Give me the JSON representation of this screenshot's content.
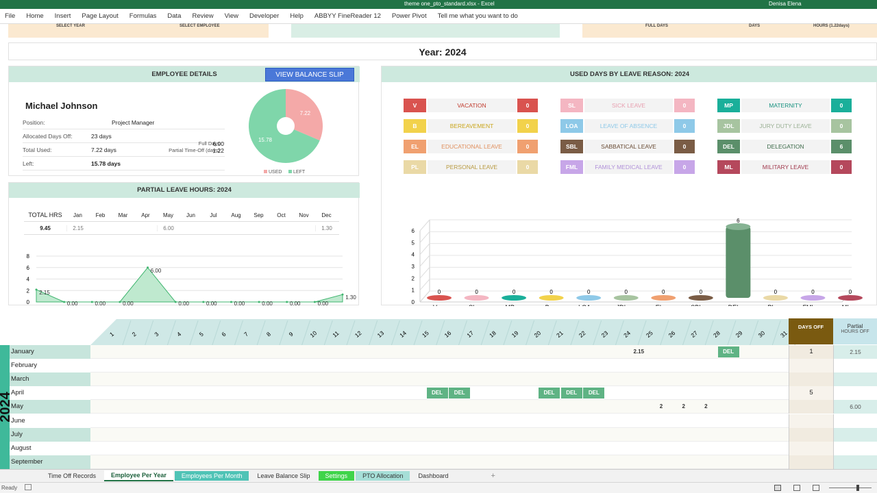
{
  "window": {
    "title": "theme one_pto_standard.xlsx - Excel",
    "user": "Denisa Elena"
  },
  "ribbon": [
    "File",
    "Home",
    "Insert",
    "Page Layout",
    "Formulas",
    "Data",
    "Review",
    "View",
    "Developer",
    "Help",
    "ABBYY FineReader 12",
    "Power Pivot",
    "Tell me what you want to do"
  ],
  "top_headers": {
    "select_year": "SELECT YEAR",
    "select_employee": "SELECT EMPLOYEE",
    "full_days": "FULL DAYS",
    "days": "DAYS",
    "hours": "HOURS (1.22days)"
  },
  "year_title": "Year: 2024",
  "employee": {
    "header": "EMPLOYEE DETAILS",
    "button": "VIEW BALANCE SLIP",
    "name": "Michael Johnson",
    "position_label": "Position:",
    "position": "Project Manager",
    "allocated_label": "Allocated Days Off:",
    "allocated": "23 days",
    "used_label": "Total Used:",
    "used": "7.22 days",
    "left_label": "Left:",
    "left": "15.78 days",
    "full_days_label": "Full Days",
    "full_days": "6.00",
    "partial_label": "Partial Time-Off (days)",
    "partial": "1.22",
    "pie": {
      "used": 7.22,
      "left": 15.78,
      "legend_used": "USED",
      "legend_left": "LEFT"
    }
  },
  "partial": {
    "header": "PARTIAL LEAVE HOURS: 2024",
    "total_label": "TOTAL HRS",
    "total": "9.45",
    "months": [
      "Jan",
      "Feb",
      "Mar",
      "Apr",
      "May",
      "Jun",
      "Jul",
      "Aug",
      "Sep",
      "Oct",
      "Nov",
      "Dec"
    ],
    "values": [
      "2.15",
      "",
      "",
      "",
      "6.00",
      "",
      "",
      "",
      "",
      "",
      "",
      "1.30"
    ]
  },
  "used_days": {
    "header": "USED DAYS BY LEAVE REASON: 2024",
    "reasons": [
      {
        "code": "V",
        "name": "VACATION",
        "val": "0",
        "color": "#d9534f",
        "vcolor": "#d9534f",
        "tcolor": "#c0392b"
      },
      {
        "code": "SL",
        "name": "SICK LEAVE",
        "val": "0",
        "color": "#f4b6c2",
        "vcolor": "#f4b6c2",
        "tcolor": "#e8a0b0"
      },
      {
        "code": "MP",
        "name": "MATERNITY",
        "val": "0",
        "color": "#1aaf9a",
        "vcolor": "#1aaf9a",
        "tcolor": "#16917f"
      },
      {
        "code": "B",
        "name": "BEREAVEMENT",
        "val": "0",
        "color": "#f2d24b",
        "vcolor": "#f2d24b",
        "tcolor": "#c9a51a"
      },
      {
        "code": "LOA",
        "name": "LEAVE OF ABSENCE",
        "val": "0",
        "color": "#8ec9e8",
        "vcolor": "#8ec9e8",
        "tcolor": "#8ec9e8"
      },
      {
        "code": "JDL",
        "name": "JURY DUTY LEAVE",
        "val": "0",
        "color": "#a7c4a0",
        "vcolor": "#a7c4a0",
        "tcolor": "#9ab094"
      },
      {
        "code": "EL",
        "name": "EDUCATIONAL LEAVE",
        "val": "0",
        "color": "#f0a070",
        "vcolor": "#f0a070",
        "tcolor": "#e0905e"
      },
      {
        "code": "SBL",
        "name": "SABBATICAL LEAVE",
        "val": "0",
        "color": "#7a5c45",
        "vcolor": "#7a5c45",
        "tcolor": "#6a4c35"
      },
      {
        "code": "DEL",
        "name": "DELEGATION",
        "val": "6",
        "color": "#5b8f6a",
        "vcolor": "#5b8f6a",
        "tcolor": "#3d6b4a"
      },
      {
        "code": "PL",
        "name": "PERSONAL LEAVE",
        "val": "0",
        "color": "#ead9a6",
        "vcolor": "#ead9a6",
        "tcolor": "#b89a40"
      },
      {
        "code": "FML",
        "name": "FAMILY MEDICAL LEAVE",
        "val": "0",
        "color": "#c7a6e8",
        "vcolor": "#c7a6e8",
        "tcolor": "#b090d8"
      },
      {
        "code": "ML",
        "name": "MILITARY LEAVE",
        "val": "0",
        "color": "#b5485c",
        "vcolor": "#b5485c",
        "tcolor": "#a13a4e"
      }
    ]
  },
  "calendar": {
    "year_label": "2024",
    "days_off_label": "DAYS OFF",
    "partial_label": "Partial",
    "hours_off_label": "HOURS OFF",
    "months": [
      {
        "name": "January",
        "days_off": "1",
        "hours": "2.15",
        "cells": {
          "26": "2.15",
          "30": "DEL"
        }
      },
      {
        "name": "February",
        "days_off": "",
        "hours": "",
        "cells": {}
      },
      {
        "name": "March",
        "days_off": "",
        "hours": "",
        "cells": {}
      },
      {
        "name": "April",
        "days_off": "5",
        "hours": "",
        "cells": {
          "17": "DEL",
          "18": "DEL",
          "22": "DEL",
          "23": "DEL",
          "24": "DEL"
        }
      },
      {
        "name": "May",
        "days_off": "",
        "hours": "6.00",
        "cells": {
          "27": "2",
          "28": "2",
          "29": "2"
        }
      },
      {
        "name": "June",
        "days_off": "",
        "hours": "",
        "cells": {}
      },
      {
        "name": "July",
        "days_off": "",
        "hours": "",
        "cells": {}
      },
      {
        "name": "August",
        "days_off": "",
        "hours": "",
        "cells": {}
      },
      {
        "name": "September",
        "days_off": "",
        "hours": "",
        "cells": {}
      }
    ]
  },
  "tabs": [
    "Time Off Records",
    "Employee Per Year",
    "Employees Per Month",
    "Leave Balance Slip",
    "Settings",
    "PTO Allocation",
    "Dashboard"
  ],
  "status": {
    "ready": "Ready"
  },
  "chart_data": [
    {
      "type": "line",
      "title": "PARTIAL LEAVE HOURS: 2024",
      "categories": [
        "Jan",
        "Feb",
        "Mar",
        "Apr",
        "May",
        "Jun",
        "Jul",
        "Aug",
        "Sep",
        "Oct",
        "Nov",
        "Dec"
      ],
      "values": [
        2.15,
        0,
        0,
        0,
        6,
        0,
        0,
        0,
        0,
        0,
        0,
        1.3
      ],
      "labels": [
        "2.15",
        "0.00",
        "0.00",
        "0.00",
        "6.00",
        "0.00",
        "0.00",
        "0.00",
        "0.00",
        "0.00",
        "0.00",
        "1.30"
      ],
      "ylim": [
        0,
        8
      ],
      "yticks": [
        0,
        2,
        4,
        6,
        8
      ]
    },
    {
      "type": "bar",
      "title": "USED DAYS BY LEAVE REASON: 2024",
      "categories": [
        "V",
        "SL",
        "MP",
        "B",
        "LOA",
        "JDL",
        "EL",
        "SBL",
        "DEL",
        "PL",
        "FML",
        "ML"
      ],
      "values": [
        0,
        0,
        0,
        0,
        0,
        0,
        0,
        0,
        6,
        0,
        0,
        0
      ],
      "ylim": [
        0,
        6
      ],
      "yticks": [
        0,
        1,
        2,
        3,
        4,
        5,
        6
      ]
    },
    {
      "type": "pie",
      "categories": [
        "USED",
        "LEFT"
      ],
      "values": [
        7.22,
        15.78
      ]
    }
  ]
}
